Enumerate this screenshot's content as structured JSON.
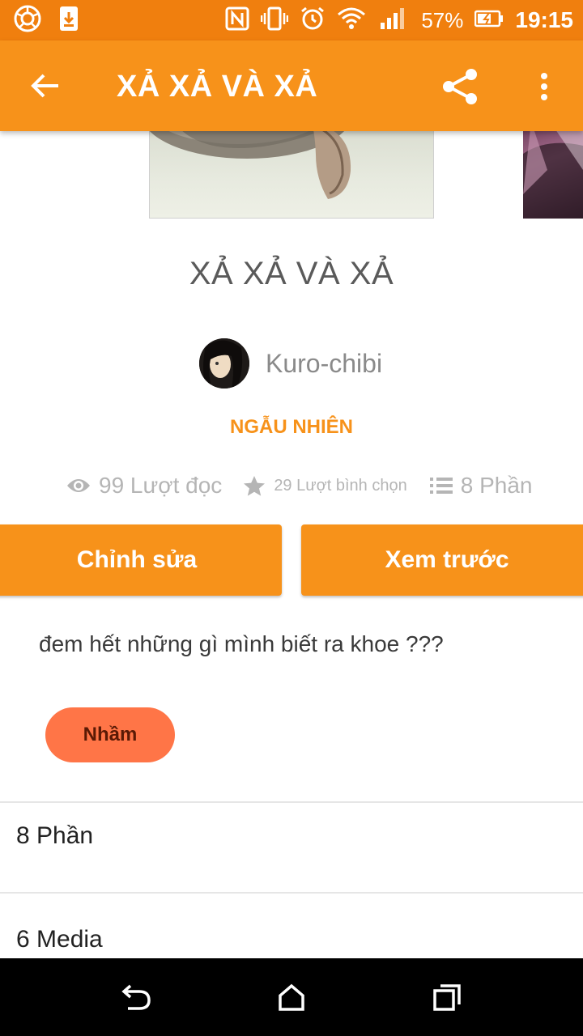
{
  "status_bar": {
    "battery_percent": "57%",
    "time": "19:15",
    "icons": [
      "app-icon",
      "download-icon",
      "nfc-icon",
      "vibrate-icon",
      "alarm-icon",
      "wifi-icon",
      "signal-icon",
      "battery-icon"
    ]
  },
  "app_bar": {
    "title": "XẢ XẢ VÀ XẢ",
    "background": "#F7921A"
  },
  "story": {
    "title": "XẢ XẢ VÀ XẢ",
    "author": "Kuro-chibi",
    "category": "NGẪU NHIÊN",
    "stats": {
      "reads": "99 Lượt đọc",
      "votes": "29 Lượt bình chọn",
      "parts": "8 Phần"
    },
    "description": "đem hết những gì mình biết ra khoe ???",
    "tag": "Nhầm"
  },
  "actions": {
    "edit_label": "Chỉnh sửa",
    "preview_label": "Xem trước"
  },
  "sections": {
    "parts_label": "8 Phần",
    "media_label": "6 Media"
  },
  "colors": {
    "status_bar": "#F07F0E",
    "accent": "#F7921A",
    "tag": "#FF7547",
    "nav_bar": "#000000"
  }
}
